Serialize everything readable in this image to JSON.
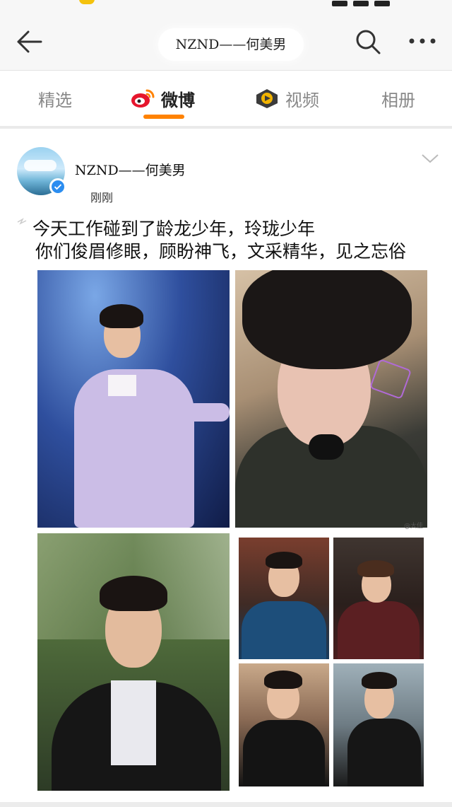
{
  "nav": {
    "back_icon": "back-arrow-icon",
    "title": "NZND——何美男",
    "search_icon": "search-icon",
    "more_icon": "more-icon"
  },
  "tabs": [
    {
      "label": "精选",
      "icon": null,
      "active": false
    },
    {
      "label": "微博",
      "icon": "weibo-logo-icon",
      "active": true
    },
    {
      "label": "视频",
      "icon": "video-icon",
      "active": false
    },
    {
      "label": "相册",
      "icon": null,
      "active": false
    }
  ],
  "colors": {
    "accent": "#ff8200",
    "verified": "#2b8df0",
    "inactive_tab": "#888888"
  },
  "post": {
    "username": "NZND——何美男",
    "time": "刚刚",
    "text_line1": "今天工作碰到了龄龙少年，玲珑少年",
    "text_line2": "你们俊眉修眼，顾盼神飞，文采精华，见之忘俗",
    "watermark": "@大佳"
  }
}
